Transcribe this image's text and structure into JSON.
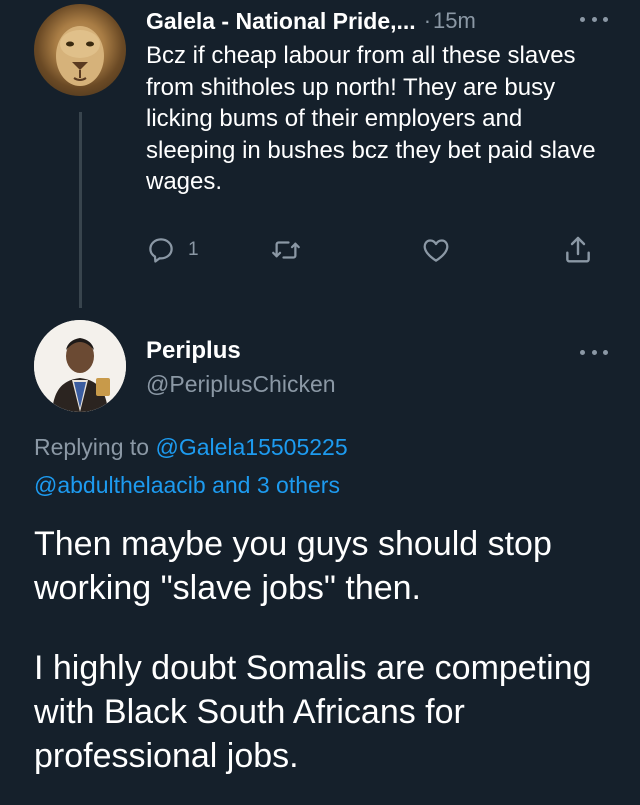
{
  "reply_tweet": {
    "display_name": "Galela - National Pride,...",
    "separator": "·",
    "timestamp": "15m",
    "text": "Bcz if cheap labour from all these slaves from shitholes up north! They are busy licking bums of their employers and sleeping in bushes bcz they bet paid slave wages.",
    "reply_count": "1",
    "icons": [
      "reply-icon",
      "retweet-icon",
      "like-icon",
      "share-icon",
      "more-icon"
    ]
  },
  "main_tweet": {
    "display_name": "Periplus",
    "handle": "@PeriplusChicken",
    "replying_to_label": "Replying to",
    "mention_1": "@Galela15505225",
    "mention_2": "@abdulthelaacib",
    "and_label": "and",
    "others": "3 others",
    "paragraphs": [
      "Then maybe you guys should stop working \"slave jobs\" then.",
      "I highly doubt Somalis are competing with Black South Africans for professional jobs."
    ]
  },
  "colors": {
    "background": "#15202b",
    "primary_text": "#ffffff",
    "secondary_text": "#8b98a5",
    "link": "#1d9bf0",
    "thread_line": "#38444d"
  }
}
